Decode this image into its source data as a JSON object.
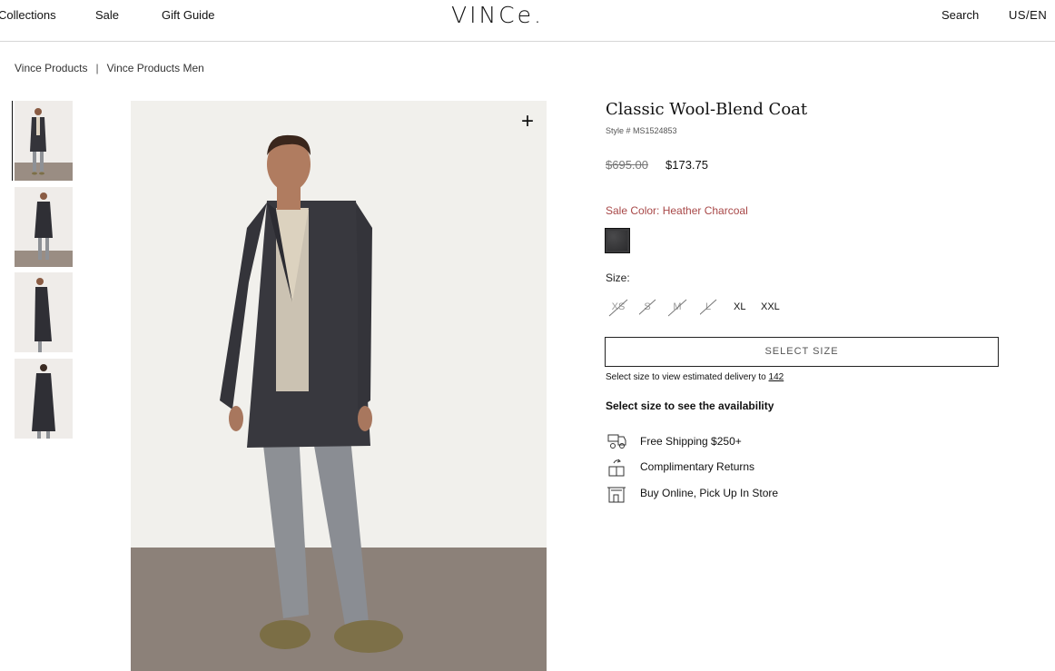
{
  "header": {
    "nav": [
      "Collections",
      "Sale",
      "Gift Guide"
    ],
    "logo": "VINCe.",
    "search": "Search",
    "locale": "US/EN"
  },
  "breadcrumb": [
    "Vince Products",
    "Vince Products Men"
  ],
  "breadcrumb_separator": "|",
  "product": {
    "title": "Classic Wool-Blend Coat",
    "style": "Style # MS1524853",
    "price_original": "$695.00",
    "price_sale": "$173.75",
    "color_label": "Sale Color: Heather Charcoal",
    "swatch_color": "#3a3a3c",
    "size_label": "Size:",
    "sizes": [
      {
        "label": "XS",
        "available": false
      },
      {
        "label": "S",
        "available": false
      },
      {
        "label": "M",
        "available": false
      },
      {
        "label": "L",
        "available": false
      },
      {
        "label": "XL",
        "available": true
      },
      {
        "label": "XXL",
        "available": true
      }
    ],
    "select_button": "SELECT SIZE",
    "delivery_text": "Select size to view estimated delivery to ",
    "delivery_zip": "142",
    "availability": "Select size to see the availability",
    "perks": [
      "Free Shipping $250+",
      "Complimentary Returns",
      "Buy Online, Pick Up In Store"
    ]
  },
  "gallery": {
    "thumbnail_count": 4,
    "zoom_icon": "plus-icon"
  },
  "colors": {
    "sale_red": "#a84848",
    "coat": "#3a3a3c",
    "background": "#f1f0ec",
    "floor": "#8c8179"
  }
}
